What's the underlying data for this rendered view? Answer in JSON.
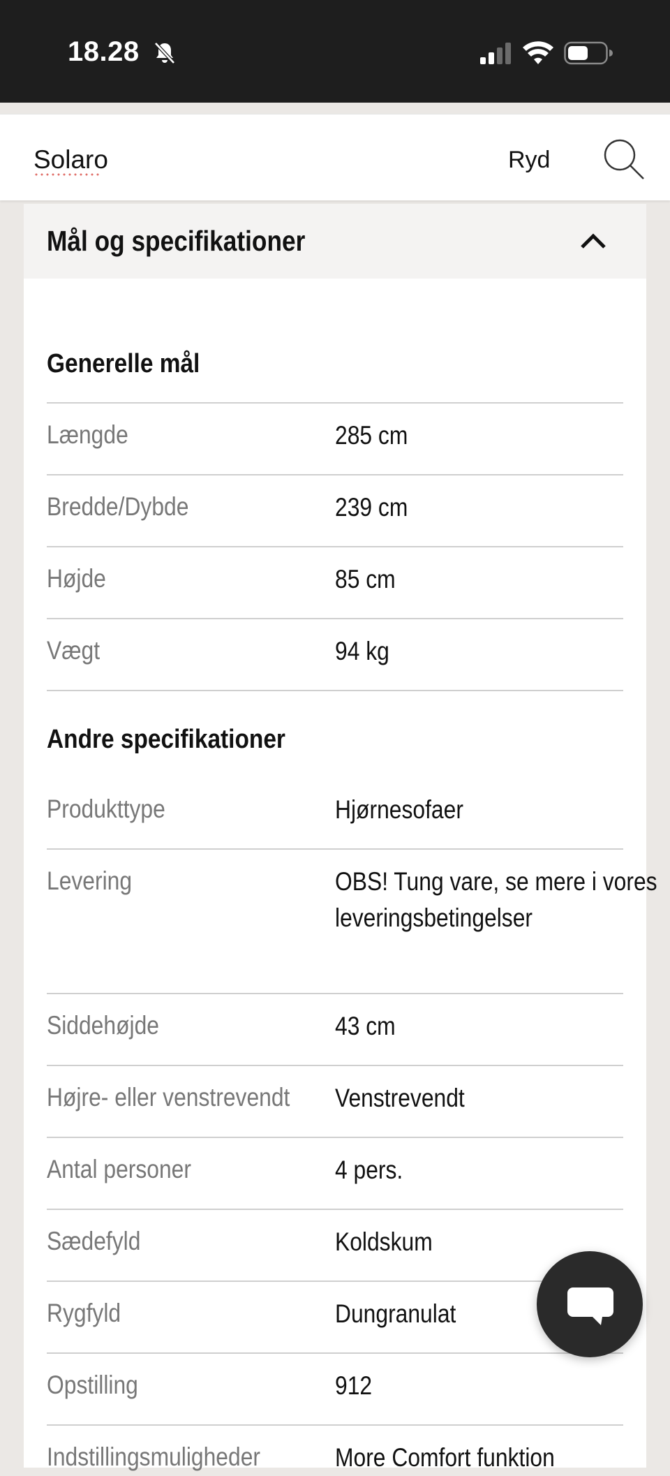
{
  "status_bar": {
    "time": "18.28",
    "icons": [
      "bell-slash-icon",
      "signal-icon",
      "wifi-icon",
      "battery-icon"
    ]
  },
  "search": {
    "query": "Solaro",
    "clear_label": "Ryd",
    "icon": "search-icon"
  },
  "card": {
    "title": "Mål og specifikationer",
    "collapse_icon": "chevron-up-icon"
  },
  "general": {
    "title": "Generelle mål",
    "rows": [
      {
        "label": "Længde",
        "value": "285 cm"
      },
      {
        "label": "Bredde/Dybde",
        "value": "239 cm"
      },
      {
        "label": "Højde",
        "value": "85 cm"
      },
      {
        "label": "Vægt",
        "value": "94 kg"
      }
    ]
  },
  "other": {
    "title": "Andre specifikationer",
    "rows": [
      {
        "label": "Produkttype",
        "value": "Hjørnesofaer"
      },
      {
        "label": "Levering",
        "value": "OBS! Tung vare, se mere i vores leveringsbetingelser"
      },
      {
        "label": "Siddehøjde",
        "value": "43 cm"
      },
      {
        "label": "Højre- eller venstrevendt",
        "value": "Venstrevendt"
      },
      {
        "label": "Antal personer",
        "value": "4 pers."
      },
      {
        "label": "Sædefyld",
        "value": "Koldskum"
      },
      {
        "label": "Rygfyld",
        "value": "Dungranulat"
      },
      {
        "label": "Opstilling",
        "value": "912"
      },
      {
        "label": "Indstillingsmuligheder",
        "value": "More Comfort funktion"
      }
    ]
  },
  "chat": {
    "icon": "chat-bubble-icon"
  }
}
